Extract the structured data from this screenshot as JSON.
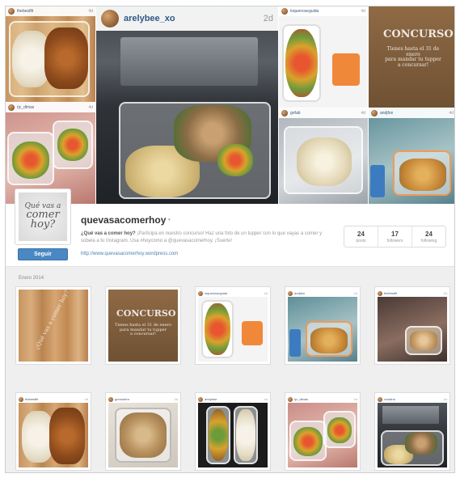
{
  "featured": {
    "username": "arelybee_xo",
    "time": "2d",
    "photo": "couscous-veggie-tupper"
  },
  "collage": [
    {
      "username": "thebestfit",
      "time": "4d",
      "photo": "rice-stew"
    },
    {
      "username": "rjc_dlmas",
      "time": "4d",
      "photo": "veggie-containers"
    },
    {
      "username": "loquenoseguida",
      "time": "4d",
      "photo": "salad-and-orange"
    },
    {
      "username": "",
      "time": "",
      "photo": "contest-sign"
    },
    {
      "username": "gnfab",
      "time": "4d",
      "photo": "cauliflower-egg"
    },
    {
      "username": "andjfon",
      "time": "4d",
      "photo": "blue-container"
    }
  ],
  "profile": {
    "logo_lines": [
      "Qué vas a",
      "comer",
      "hoy?"
    ],
    "follow_label": "Seguir",
    "username": "quevasacomerhoy",
    "username_dot": "•",
    "bio_bold": "¿Qué vas a comer hoy?",
    "bio_text": " ¡Participa en nuestro concurso! Haz una foto de un tupper con lo que vayas a comer y súbela a tu Instagram. Usa #hoycomo a @quevasacomerhoy. ¡Suerte!",
    "website": "http://www.quevasacomerhoy.wordpress.com",
    "stats": [
      {
        "value": "24",
        "label": "posts"
      },
      {
        "value": "17",
        "label": "followers"
      },
      {
        "value": "24",
        "label": "following"
      }
    ]
  },
  "grid": {
    "date_label": "Enero 2014",
    "posts": [
      {
        "username": "",
        "time": "",
        "photo": "wood-sign"
      },
      {
        "username": "",
        "time": "",
        "photo": "contest-sign"
      },
      {
        "username": "loquenoseguida",
        "time": "4d",
        "photo": "salad-and-orange"
      },
      {
        "username": "andjfon",
        "time": "4d",
        "photo": "blue-container"
      },
      {
        "username": "thebestfit",
        "time": "4d",
        "photo": "dim-meal"
      },
      {
        "username": "thebestfit",
        "time": "4d",
        "photo": "rice-stew"
      },
      {
        "username": "gnmodern",
        "time": "4d",
        "photo": "pasta-tupper"
      },
      {
        "username": "arelybee",
        "time": "4d",
        "photo": "two-containers-dark"
      },
      {
        "username": "rjc_dlmas",
        "time": "4d",
        "photo": "veggie-containers"
      },
      {
        "username": "crsalina",
        "time": "4d",
        "photo": "couscous-tupper"
      }
    ]
  }
}
